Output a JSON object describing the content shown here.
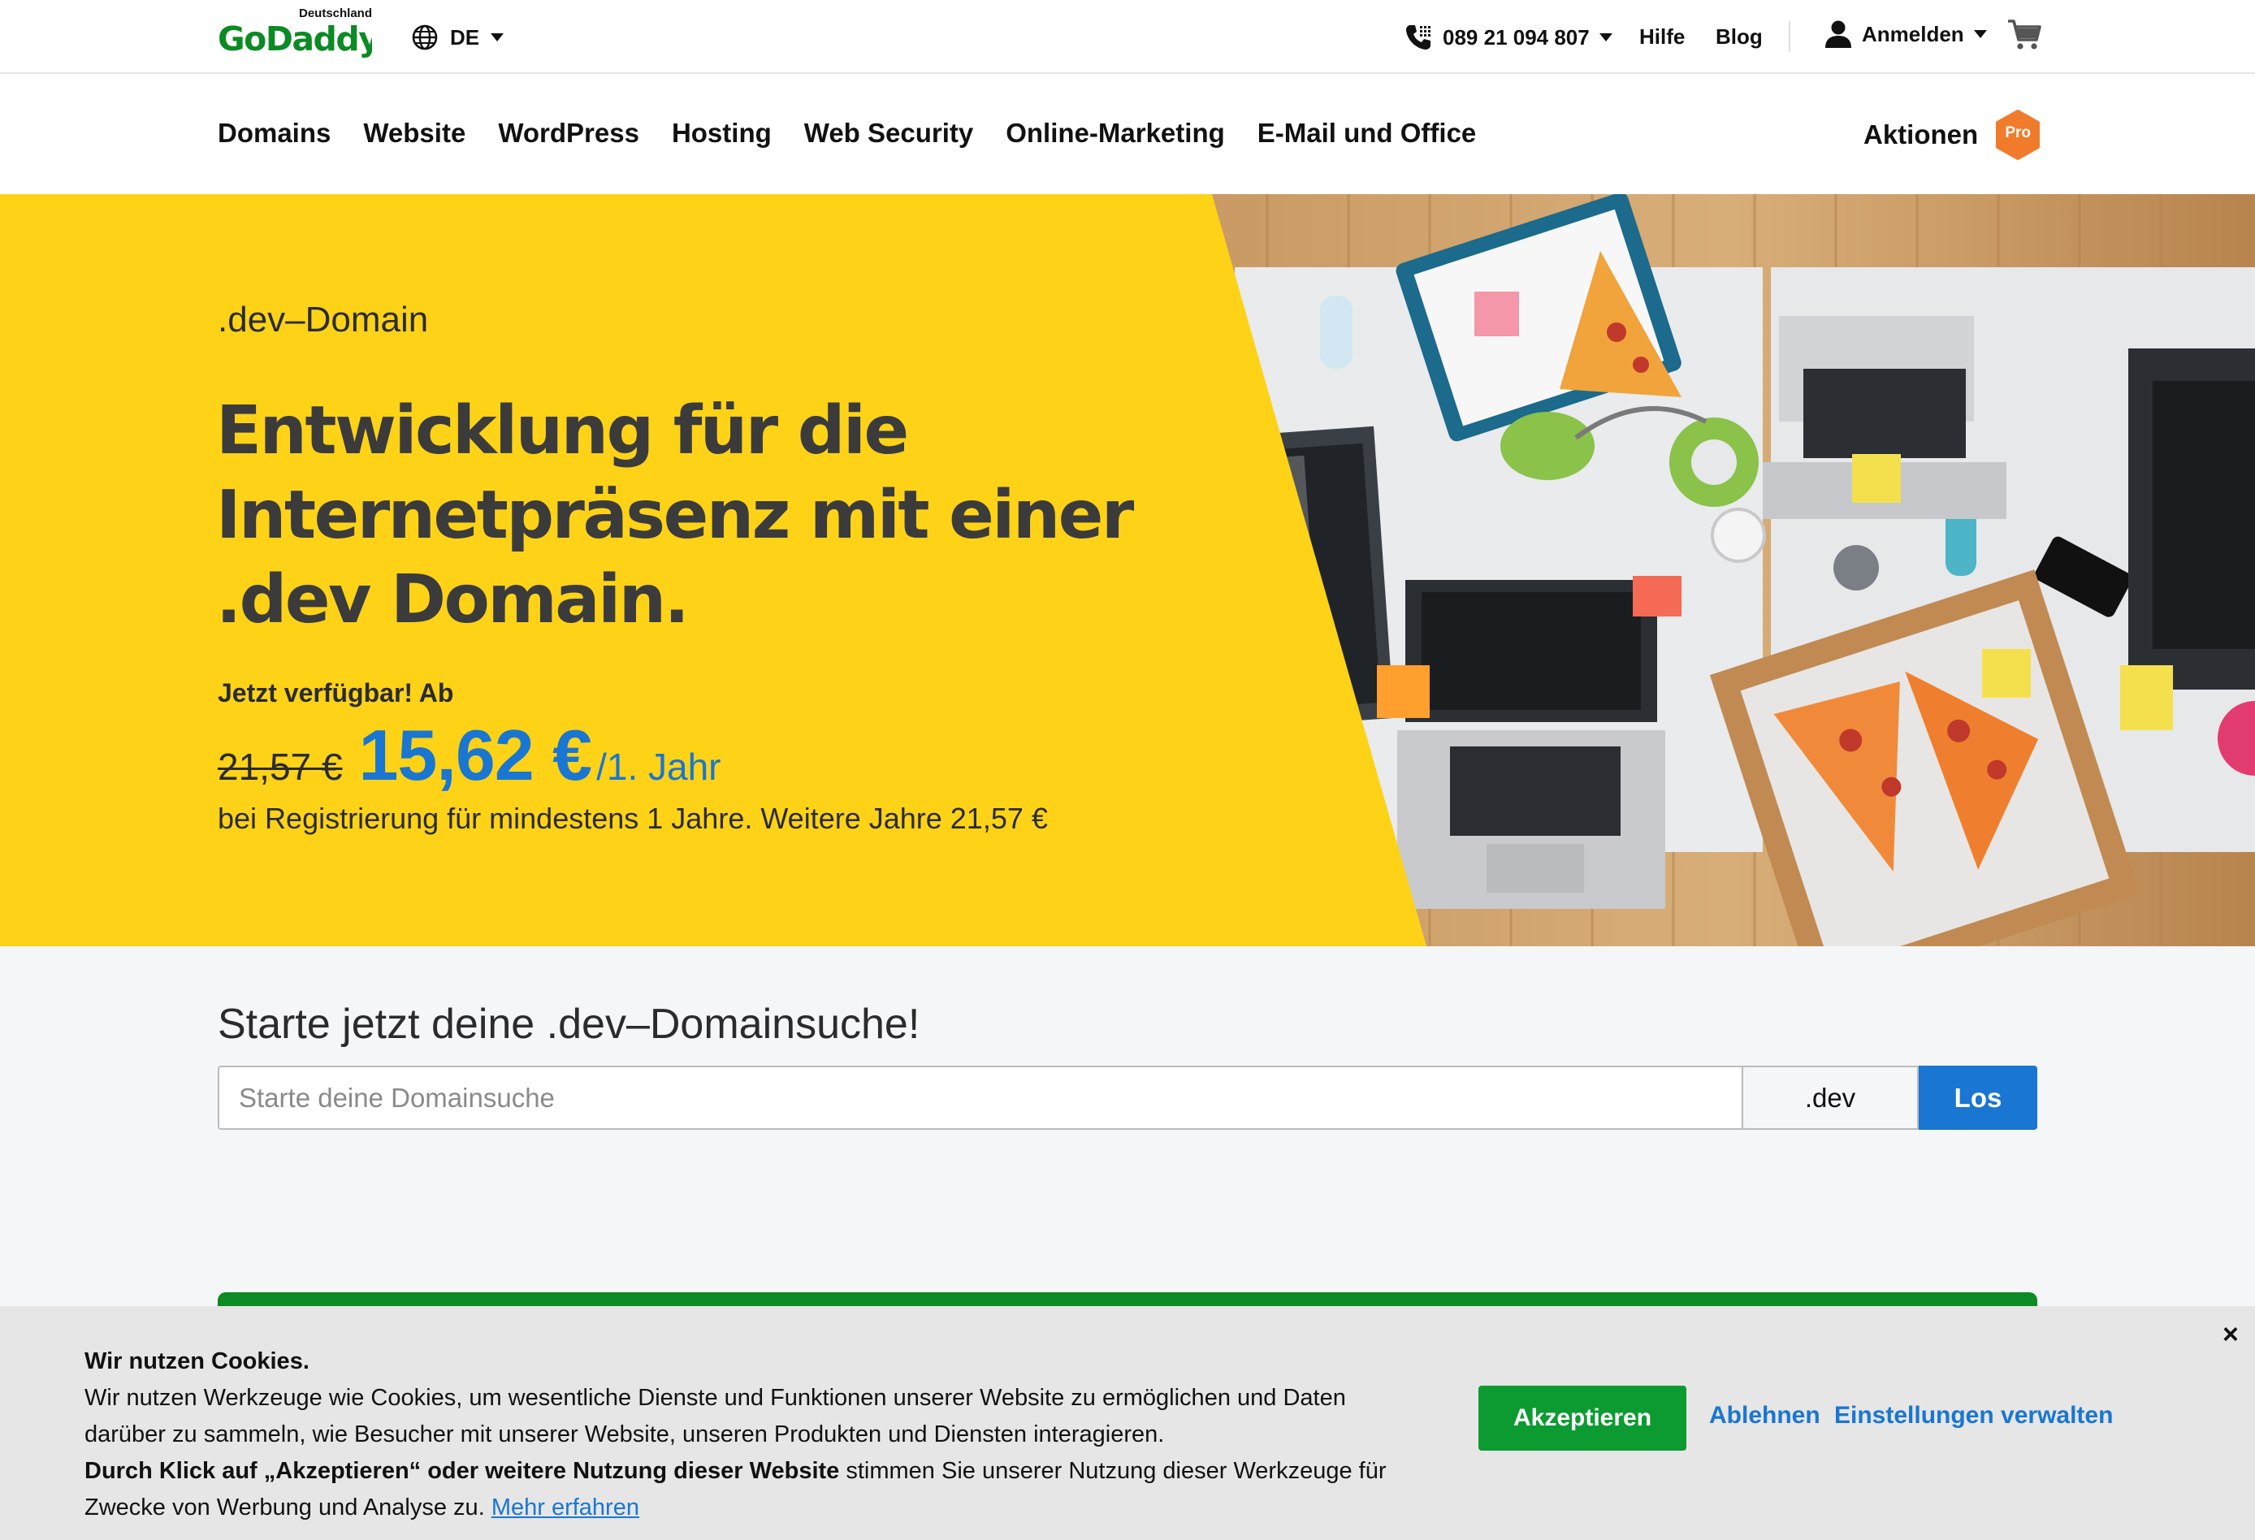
{
  "header": {
    "logo_country": "Deutschland",
    "logo_brand": "GoDaddy",
    "language": "DE",
    "phone": "089 21 094 807",
    "help": "Hilfe",
    "blog": "Blog",
    "signin": "Anmelden"
  },
  "nav": {
    "items": [
      "Domains",
      "Website",
      "WordPress",
      "Hosting",
      "Web Security",
      "Online-Marketing",
      "E-Mail und Office"
    ],
    "promotions": "Aktionen",
    "pro_badge": "Pro"
  },
  "hero": {
    "eyebrow": ".dev–Domain",
    "headline": "Entwicklung für die Internetpräsenz mit einer .dev Domain.",
    "availability": "Jetzt verfügbar! Ab",
    "old_price": "21,57 €",
    "new_price": "15,62 €",
    "period": "/1. Jahr",
    "terms": "bei Registrierung für mindestens 1 Jahre. Weitere Jahre 21,57 €"
  },
  "search": {
    "title": "Starte jetzt deine .dev–Domainsuche!",
    "placeholder": "Starte deine Domainsuche",
    "value": "",
    "tld": ".dev",
    "button": "Los"
  },
  "cookie": {
    "title": "Wir nutzen Cookies.",
    "body": "Wir nutzen Werkzeuge wie Cookies, um wesentliche Dienste und Funktionen unserer Website zu ermöglichen und Daten darüber zu sammeln, wie Besucher mit unserer Website, unseren Produkten und Diensten interagieren.",
    "consent_bold": "Durch Klick auf „Akzeptieren“ oder weitere Nutzung dieser Website",
    "consent_rest": "stimmen Sie unserer Nutzung dieser Werkzeuge für Zwecke von Werbung und Analyse zu.",
    "learn_more": "Mehr erfahren",
    "accept": "Akzeptieren",
    "decline": "Ablehnen",
    "manage": "Einstellungen verwalten",
    "close": "×"
  },
  "colors": {
    "brand_green": "#1bdbdb",
    "hero_yellow": "#fed317",
    "price_blue": "#1976d2",
    "accept_green": "#0c9b31",
    "pro_orange": "#f07c2b"
  }
}
